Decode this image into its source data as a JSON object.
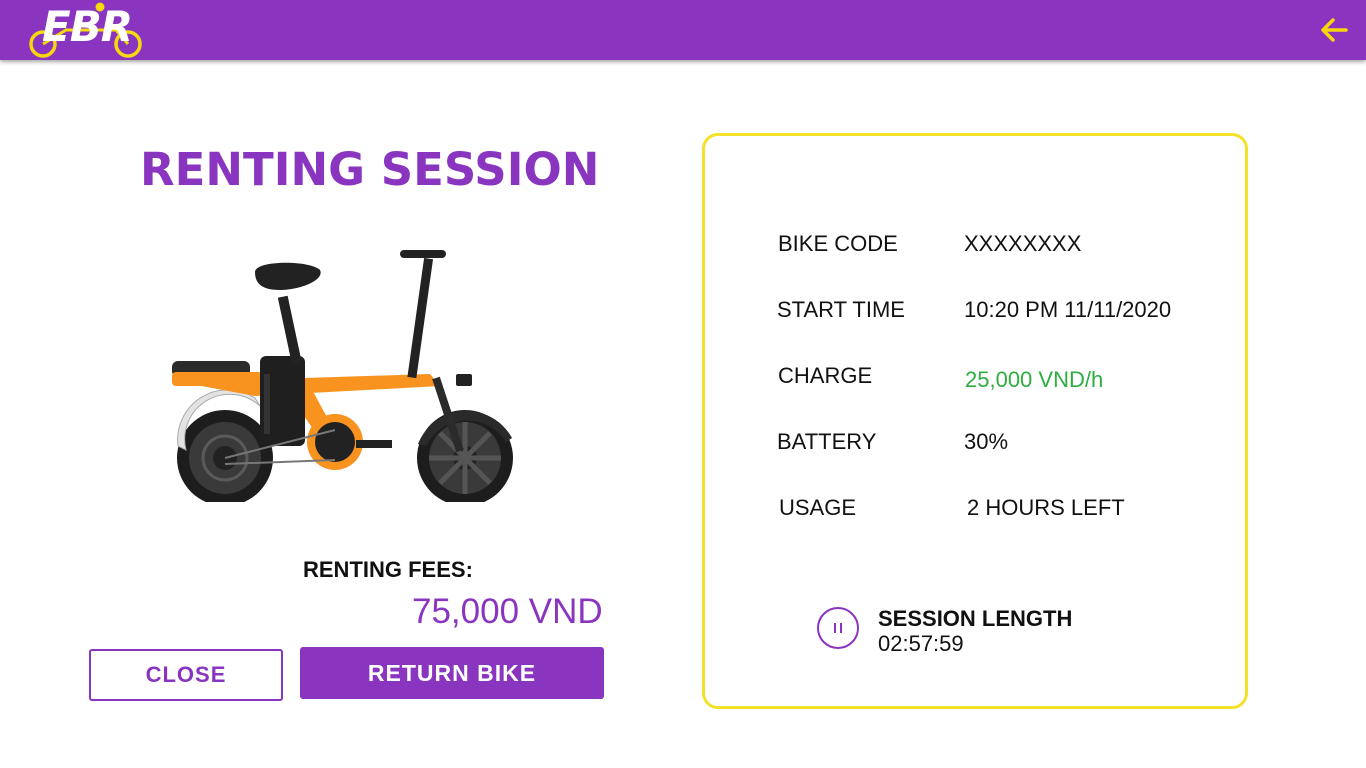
{
  "header": {
    "logo_text": "EBR",
    "background": "#8a35c0",
    "accent": "#f5d90a",
    "back_icon": "arrow-left-icon"
  },
  "page": {
    "title": "RENTING SESSION"
  },
  "fees": {
    "label": "RENTING FEES:",
    "value": "75,000 VND"
  },
  "buttons": {
    "close": "CLOSE",
    "return_bike": "RETURN BIKE"
  },
  "details": [
    {
      "label": "BIKE CODE",
      "value": "XXXXXXXX"
    },
    {
      "label": "START TIME",
      "value": "10:20 PM 11/11/2020"
    },
    {
      "label": "CHARGE",
      "value": "25,000 VND/h",
      "value_color": "#2eae3f"
    },
    {
      "label": "BATTERY",
      "value": "30%"
    },
    {
      "label": "USAGE",
      "value": "2 HOURS LEFT"
    }
  ],
  "session": {
    "label": "SESSION LENGTH",
    "value": "02:57:59",
    "control_icon": "pause-icon"
  },
  "colors": {
    "primary": "#8a35c0",
    "card_border": "#f5e02a",
    "positive": "#2eae3f",
    "bike_body": "#f7931e"
  }
}
